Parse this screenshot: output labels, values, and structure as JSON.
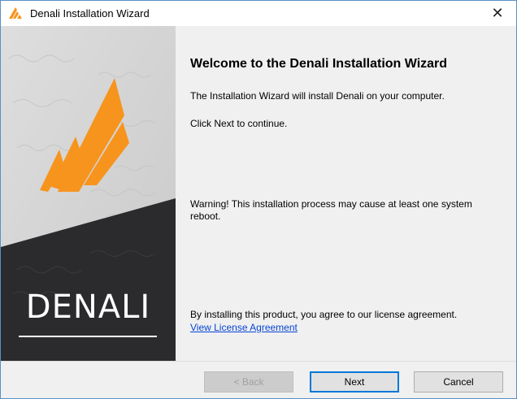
{
  "window": {
    "title": "Denali Installation Wizard",
    "close_glyph": "✕",
    "icon": "denali-logo-icon"
  },
  "banner": {
    "brand_text": "DENALI",
    "colors": {
      "accent_orange": "#f7941d",
      "dark_panel": "#2b2b2d",
      "light_panel": "#d4d4d4"
    }
  },
  "content": {
    "heading": "Welcome to the Denali Installation Wizard",
    "intro": "The Installation Wizard will install Denali on your computer.",
    "continue_hint": "Click Next to continue.",
    "warning": "Warning! This installation process may cause at least one system reboot.",
    "agreement": "By installing this product, you agree to our license agreement.",
    "license_link": "View License Agreement"
  },
  "buttons": {
    "back": "< Back",
    "next": "Next",
    "cancel": "Cancel"
  }
}
